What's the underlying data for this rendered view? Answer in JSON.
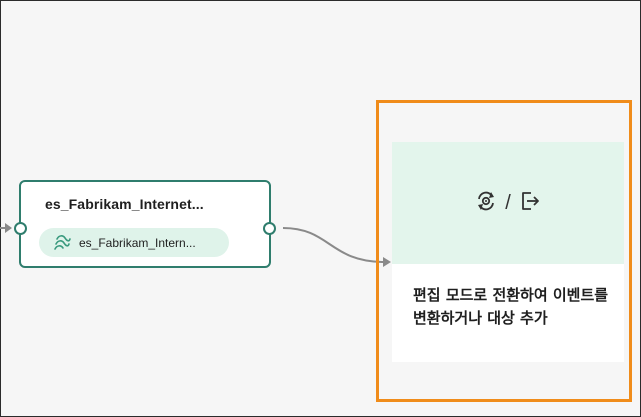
{
  "source_node": {
    "title": "es_Fabrikam_Internet...",
    "chip_label": "es_Fabrikam_Intern...",
    "chip_icon": "eventstream-icon"
  },
  "destination": {
    "icons": [
      "transform-event-icon",
      "destination-exit-icon"
    ],
    "separator": "/",
    "message": "편집 모드로 전환하여 이벤트를 변환하거나 대상 추가"
  },
  "colors": {
    "node_border": "#2f7d6d",
    "chip_bg": "#dff3ea",
    "panel_highlight": "#f08c1a",
    "dest_top_bg": "#e3f5ec",
    "canvas_bg": "#f6f6f6"
  }
}
